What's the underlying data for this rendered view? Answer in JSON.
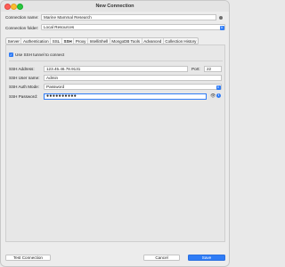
{
  "window": {
    "title": "New Connection"
  },
  "connection": {
    "name_label": "Connection name:",
    "name_value": "Marine Mammal Research",
    "folder_label": "Connection folder:",
    "folder_value": "Local Resources"
  },
  "tabs": [
    {
      "label": "Server"
    },
    {
      "label": "Authentication"
    },
    {
      "label": "SSL"
    },
    {
      "label": "SSH",
      "active": true
    },
    {
      "label": "Proxy"
    },
    {
      "label": "IntelliShell"
    },
    {
      "label": "MongoDB Tools"
    },
    {
      "label": "Advanced"
    },
    {
      "label": "Collection History"
    }
  ],
  "ssh": {
    "use_tunnel_label": "Use SSH tunnel to connect",
    "use_tunnel_checked": true,
    "address_label": "SSH Address:",
    "address_value": "123.45.46.78.9131",
    "port_label": "Port:",
    "port_value": "22",
    "user_label": "SSH User name:",
    "user_value": "Admin",
    "auth_label": "SSH Auth Mode:",
    "auth_value": "Password",
    "password_label": "SSH Password:",
    "password_value": "●●●●●●●●●●"
  },
  "footer": {
    "test_label": "Test Connection",
    "cancel_label": "Cancel",
    "save_label": "Save"
  },
  "colors": {
    "accent": "#2f7cf6"
  }
}
